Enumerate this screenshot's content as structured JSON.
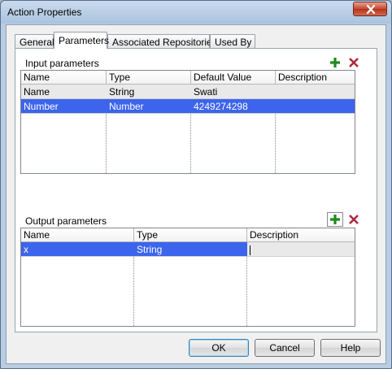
{
  "window": {
    "title": "Action Properties"
  },
  "tabs": [
    {
      "label": "General"
    },
    {
      "label": "Parameters"
    },
    {
      "label": "Associated Repositories"
    },
    {
      "label": "Used By"
    }
  ],
  "input_parameters": {
    "label": "Input parameters",
    "columns": [
      "Name",
      "Type",
      "Default Value",
      "Description"
    ],
    "rows": [
      [
        "Name",
        "String",
        "Swati",
        ""
      ],
      [
        "Number",
        "Number",
        "4249274298",
        ""
      ]
    ]
  },
  "output_parameters": {
    "label": "Output parameters",
    "columns": [
      "Name",
      "Type",
      "Description"
    ],
    "rows": [
      [
        "x",
        "String",
        ""
      ]
    ]
  },
  "buttons": {
    "ok": "OK",
    "cancel": "Cancel",
    "help": "Help"
  },
  "colors": {
    "selection": "#3c64ec",
    "add_icon": "#1f8a1f",
    "remove_icon": "#b0283c"
  }
}
